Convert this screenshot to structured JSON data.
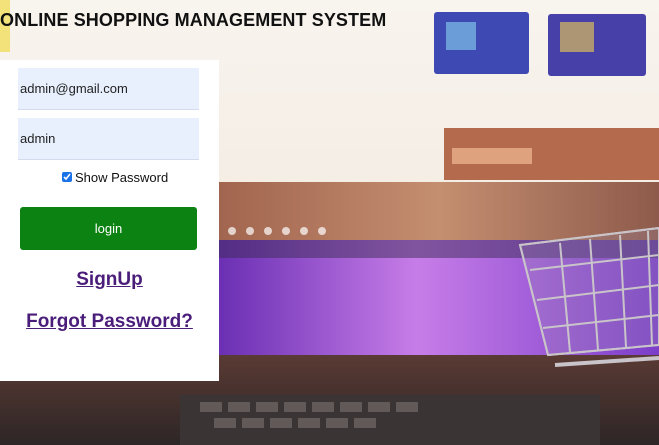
{
  "page": {
    "title": "ONLINE SHOPPING MANAGEMENT SYSTEM"
  },
  "login": {
    "email_value": "admin@gmail.com",
    "password_value": "admin",
    "show_password_label": "Show Password",
    "show_password_checked": true,
    "login_label": "login",
    "signup_label": "SignUp",
    "forgot_label": "Forgot Password?"
  },
  "colors": {
    "login_button": "#0b8211",
    "link": "#4b1d7a",
    "input_bg": "#e8f0fe"
  },
  "background": {
    "description_icon": "shopping-cart-icon"
  }
}
